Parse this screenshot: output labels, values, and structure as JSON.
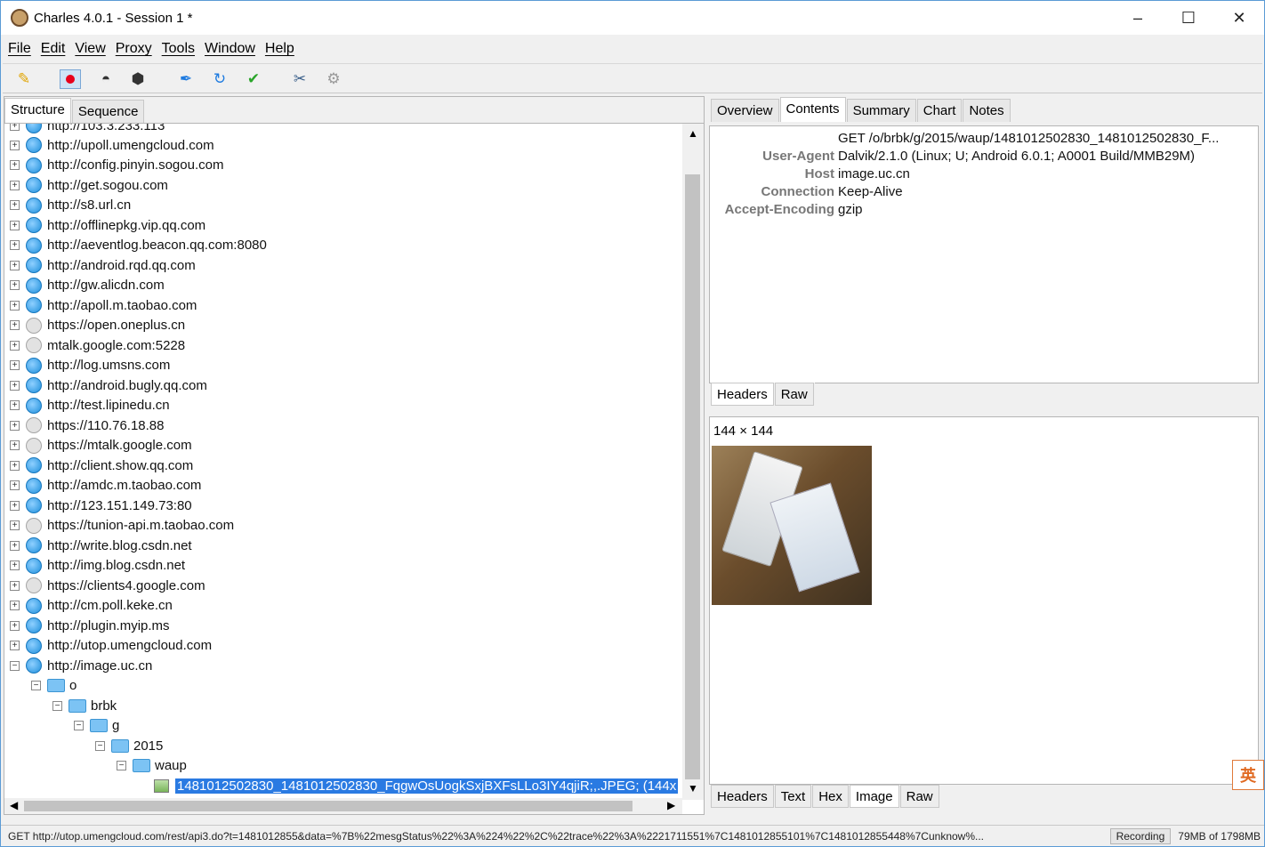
{
  "window": {
    "title": "Charles 4.0.1 - Session 1 *",
    "minimize": "–",
    "maximize": "☐",
    "close": "✕"
  },
  "menu": [
    "File",
    "Edit",
    "View",
    "Proxy",
    "Tools",
    "Window",
    "Help"
  ],
  "toolbar": {
    "icons": [
      "broom-icon",
      "record-icon",
      "turtle-icon",
      "stop-icon",
      "pen-icon",
      "refresh-icon",
      "check-icon",
      "tools-icon",
      "settings-icon"
    ],
    "colors": {
      "record": "#e8001c",
      "refresh": "#1e7be0",
      "check": "#2aa52a"
    }
  },
  "left": {
    "tabs": [
      "Structure",
      "Sequence"
    ],
    "partial_top": "http://103.3.233.113",
    "hosts": [
      {
        "label": "http://upoll.umengcloud.com",
        "secure": false
      },
      {
        "label": "http://config.pinyin.sogou.com",
        "secure": false
      },
      {
        "label": "http://get.sogou.com",
        "secure": false
      },
      {
        "label": "http://s8.url.cn",
        "secure": false
      },
      {
        "label": "http://offlinepkg.vip.qq.com",
        "secure": false
      },
      {
        "label": "http://aeventlog.beacon.qq.com:8080",
        "secure": false
      },
      {
        "label": "http://android.rqd.qq.com",
        "secure": false
      },
      {
        "label": "http://gw.alicdn.com",
        "secure": false
      },
      {
        "label": "http://apoll.m.taobao.com",
        "secure": false
      },
      {
        "label": "https://open.oneplus.cn",
        "secure": true
      },
      {
        "label": "mtalk.google.com:5228",
        "secure": true
      },
      {
        "label": "http://log.umsns.com",
        "secure": false
      },
      {
        "label": "http://android.bugly.qq.com",
        "secure": false
      },
      {
        "label": "http://test.lipinedu.cn",
        "secure": false
      },
      {
        "label": "https://110.76.18.88",
        "secure": true
      },
      {
        "label": "https://mtalk.google.com",
        "secure": true
      },
      {
        "label": "http://client.show.qq.com",
        "secure": false
      },
      {
        "label": "http://amdc.m.taobao.com",
        "secure": false
      },
      {
        "label": "http://123.151.149.73:80",
        "secure": false
      },
      {
        "label": "https://tunion-api.m.taobao.com",
        "secure": true
      },
      {
        "label": "http://write.blog.csdn.net",
        "secure": false
      },
      {
        "label": "http://img.blog.csdn.net",
        "secure": false
      },
      {
        "label": "https://clients4.google.com",
        "secure": true
      },
      {
        "label": "http://cm.poll.keke.cn",
        "secure": false
      },
      {
        "label": "http://plugin.myip.ms",
        "secure": false
      },
      {
        "label": "http://utop.umengcloud.com",
        "secure": false
      },
      {
        "label": "http://image.uc.cn",
        "secure": false
      }
    ],
    "folders": [
      "o",
      "brbk",
      "g",
      "2015",
      "waup"
    ],
    "selected_file": "1481012502830_1481012502830_FqgwOsUogkSxjBXFsLLo3IY4qjiR;,.JPEG; (144x"
  },
  "right": {
    "tabs": [
      "Overview",
      "Contents",
      "Summary",
      "Chart",
      "Notes"
    ],
    "active_tab": "Contents",
    "request_line": "GET /o/brbk/g/2015/waup/1481012502830_1481012502830_F...",
    "headers": [
      {
        "key": "User-Agent",
        "value": "Dalvik/2.1.0 (Linux; U; Android 6.0.1; A0001 Build/MMB29M)"
      },
      {
        "key": "Host",
        "value": "image.uc.cn"
      },
      {
        "key": "Connection",
        "value": "Keep-Alive"
      },
      {
        "key": "Accept-Encoding",
        "value": "gzip"
      }
    ],
    "request_subtabs": [
      "Headers",
      "Raw"
    ],
    "image_size": "144 × 144",
    "response_subtabs": [
      "Headers",
      "Text",
      "Hex",
      "Image",
      "Raw"
    ]
  },
  "ime": "英",
  "status": {
    "url": "GET http://utop.umengcloud.com/rest/api3.do?t=1481012855&data=%7B%22mesgStatus%22%3A%224%22%2C%22trace%22%3A%2221711551%7C1481012855101%7C1481012855448%7Cunknow%...",
    "recording": "Recording",
    "memory": "79MB of 1798MB"
  }
}
